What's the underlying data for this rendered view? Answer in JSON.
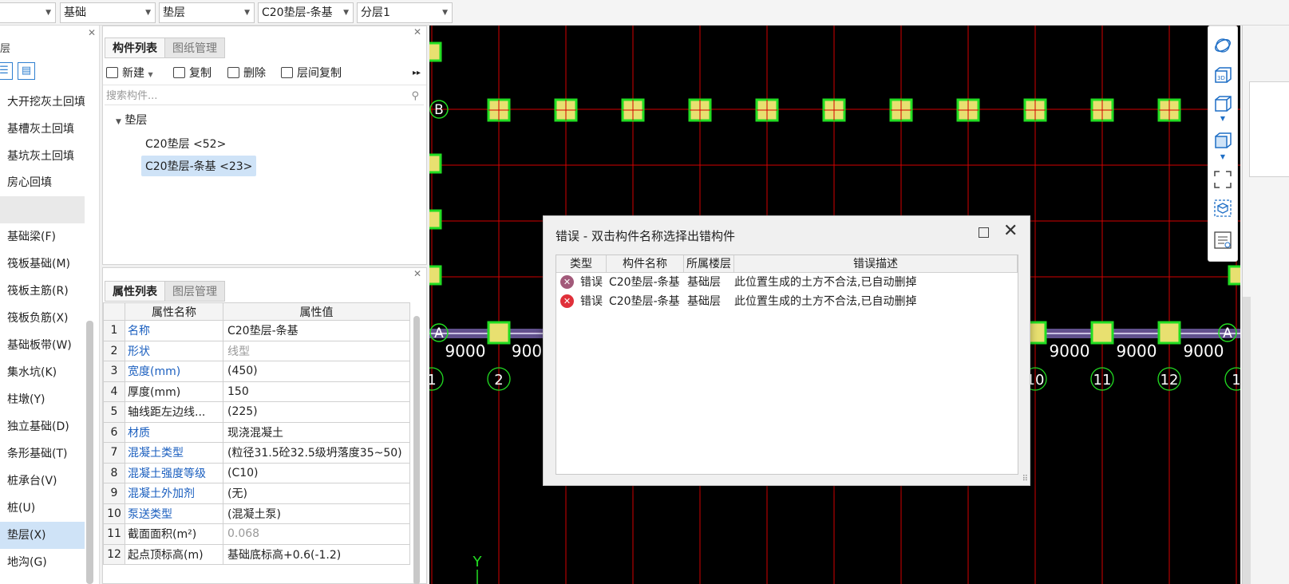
{
  "toolbar": {
    "selects": [
      {
        "value": ""
      },
      {
        "value": "基础"
      },
      {
        "value": "垫层"
      },
      {
        "value": "C20垫层-条基"
      },
      {
        "value": "分层1"
      }
    ]
  },
  "leftnav": {
    "header": "层",
    "items": [
      "大开挖灰土回填",
      "基槽灰土回填",
      "基坑灰土回填",
      "房心回填",
      "",
      "基础梁(F)",
      "筏板基础(M)",
      "筏板主筋(R)",
      "筏板负筋(X)",
      "基础板带(W)",
      "集水坑(K)",
      "柱墩(Y)",
      "独立基础(D)",
      "条形基础(T)",
      "桩承台(V)",
      "桩(U)",
      "垫层(X)",
      "地沟(G)"
    ],
    "selected": "垫层(X)"
  },
  "component_panel": {
    "tabs": [
      "构件列表",
      "图纸管理"
    ],
    "toolbar": [
      "新建",
      "复制",
      "删除",
      "层间复制"
    ],
    "search_placeholder": "搜索构件...",
    "tree": {
      "root": "垫层",
      "children": [
        "C20垫层 <52>",
        "C20垫层-条基 <23>"
      ]
    }
  },
  "property_panel": {
    "tabs": [
      "属性列表",
      "图层管理"
    ],
    "columns": [
      "属性名称",
      "属性值"
    ],
    "rows": [
      {
        "no": "1",
        "name": "名称",
        "value": "C20垫层-条基"
      },
      {
        "no": "2",
        "name": "形状",
        "value": "线型"
      },
      {
        "no": "3",
        "name": "宽度(mm)",
        "value": "(450)"
      },
      {
        "no": "4",
        "name": "厚度(mm)",
        "value": "150"
      },
      {
        "no": "5",
        "name": "轴线距左边线...",
        "value": "(225)"
      },
      {
        "no": "6",
        "name": "材质",
        "value": "现浇混凝土"
      },
      {
        "no": "7",
        "name": "混凝土类型",
        "value": "(粒径31.5砼32.5级坍落度35~50)"
      },
      {
        "no": "8",
        "name": "混凝土强度等级",
        "value": "(C10)"
      },
      {
        "no": "9",
        "name": "混凝土外加剂",
        "value": "(无)"
      },
      {
        "no": "10",
        "name": "泵送类型",
        "value": "(混凝土泵)"
      },
      {
        "no": "11",
        "name": "截面面积(m²)",
        "value": "0.068"
      },
      {
        "no": "12",
        "name": "起点顶标高(m)",
        "value": "基础底标高+0.6(-1.2)"
      }
    ]
  },
  "cad": {
    "axis_labels": [
      "B",
      "A",
      "A"
    ],
    "dimension_labels": [
      "9000",
      "900",
      "9000",
      "9000",
      "9000"
    ],
    "grid_numbers": [
      "1",
      "2",
      "10",
      "11",
      "12",
      "1"
    ],
    "y_label": "Y",
    "colors": {
      "background": "#000000",
      "grid_line": "#d40000",
      "pad_fill": "#e8e070",
      "pad_edge": "#22dd22"
    }
  },
  "error_dialog": {
    "title": "错误 - 双击构件名称选择出错构件",
    "columns": [
      "类型",
      "构件名称",
      "所属楼层",
      "错误描述"
    ],
    "rows": [
      {
        "type": "错误",
        "name": "C20垫层-条基",
        "floor": "基础层",
        "desc": "此位置生成的土方不合法,已自动删掉"
      },
      {
        "type": "错误",
        "name": "C20垫层-条基",
        "floor": "基础层",
        "desc": "此位置生成的土方不合法,已自动删掉"
      }
    ]
  },
  "right_toolbar": {
    "icons": [
      "orbit-icon",
      "3d-view-icon",
      "cube-icon",
      "cube-filled-icon",
      "fullscreen-icon",
      "select-box-icon",
      "layer-list-icon"
    ],
    "labels": [
      "3D"
    ]
  }
}
